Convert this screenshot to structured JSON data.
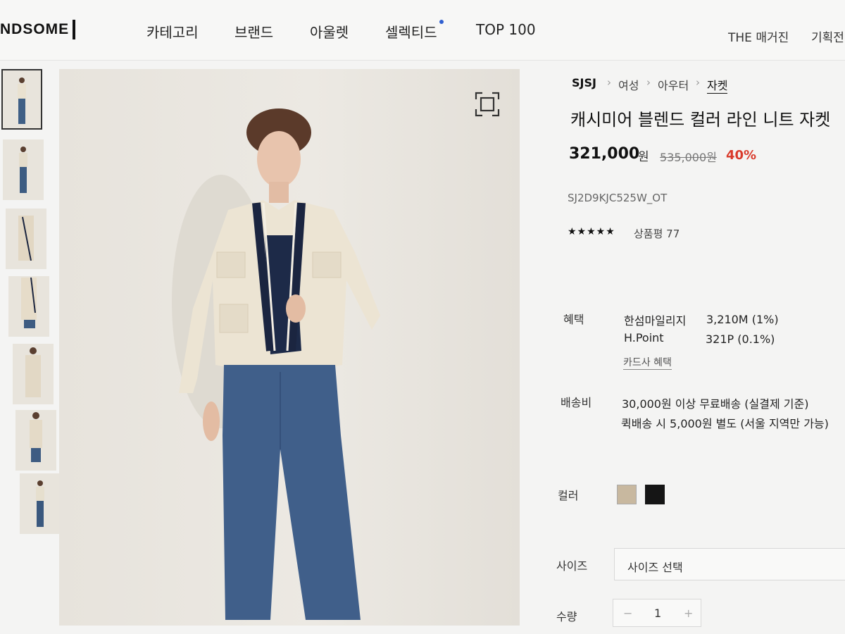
{
  "header": {
    "logo": "NDSOME",
    "nav": [
      "카테고리",
      "브랜드",
      "아울렛",
      "셀렉티드",
      "TOP 100"
    ],
    "right": [
      "THE 매거진",
      "기획전"
    ]
  },
  "thumbnails": [
    "thumb-1",
    "thumb-2",
    "thumb-3",
    "thumb-4",
    "thumb-5",
    "thumb-6",
    "thumb-7"
  ],
  "breadcrumb": [
    "SJSJ",
    "여성",
    "아우터",
    "자켓"
  ],
  "product": {
    "title": "캐시미어 블렌드 컬러 라인 니트 자켓",
    "price": "321,000",
    "currency": "원",
    "original_price": "535,000원",
    "discount": "40%",
    "code": "SJ2D9KJC525W_OT",
    "stars": "★★★★★",
    "review": "상품평 77"
  },
  "benefits": {
    "label": "혜택",
    "items": [
      {
        "name": "한섬마일리지",
        "value": "3,210M (1%)"
      },
      {
        "name": "H.Point",
        "value": "321P (0.1%)"
      }
    ],
    "card_link": "카드사 혜택"
  },
  "shipping": {
    "label": "배송비",
    "line1": "30,000원 이상 무료배송 (실결제 기준)",
    "line2": "퀵배송 시 5,000원 별도 (서울 지역만 가능)"
  },
  "color": {
    "label": "컬러",
    "swatches": [
      "#c8b89f",
      "#151515"
    ]
  },
  "size": {
    "label": "사이즈",
    "placeholder": "사이즈 선택"
  },
  "quantity": {
    "label": "수량",
    "minus": "−",
    "value": "1",
    "plus": "+"
  }
}
